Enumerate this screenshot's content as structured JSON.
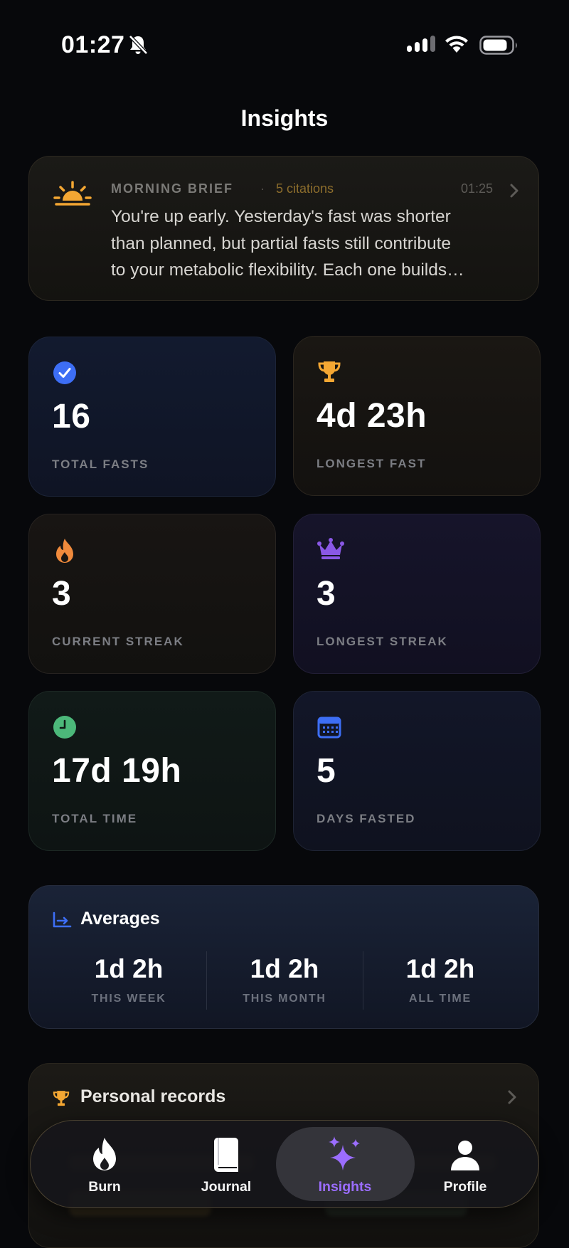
{
  "status_bar": {
    "time": "01:27"
  },
  "page": {
    "title": "Insights"
  },
  "brief": {
    "label": "MORNING BRIEF",
    "separator": "·",
    "citations": "5 citations",
    "time": "01:25",
    "lines": [
      "You're up early. Yesterday's fast was shorter",
      "than planned, but partial fasts still contribute",
      "to your metabolic flexibility. Each one builds…"
    ]
  },
  "stats": [
    {
      "icon": "check-circle-icon",
      "value": "16",
      "label": "TOTAL FASTS",
      "color": "#3d6ef5"
    },
    {
      "icon": "trophy-icon",
      "value": "4d 23h",
      "label": "LONGEST FAST",
      "color": "#f4a733"
    },
    {
      "icon": "flame-icon",
      "value": "3",
      "label": "CURRENT STREAK",
      "color": "#f08a3c"
    },
    {
      "icon": "crown-icon",
      "value": "3",
      "label": "LONGEST STREAK",
      "color": "#8a58e6"
    },
    {
      "icon": "clock-icon",
      "value": "17d 19h",
      "label": "TOTAL TIME",
      "color": "#4cb87a"
    },
    {
      "icon": "calendar-icon",
      "value": "5",
      "label": "DAYS FASTED",
      "color": "#3d6ef5"
    }
  ],
  "averages": {
    "title": "Averages",
    "items": [
      {
        "value": "1d 2h",
        "label": "THIS WEEK"
      },
      {
        "value": "1d 2h",
        "label": "THIS MONTH"
      },
      {
        "value": "1d 2h",
        "label": "ALL TIME"
      }
    ]
  },
  "records": {
    "title": "Personal records"
  },
  "tab_bar": {
    "items": [
      {
        "label": "Burn",
        "icon": "flame-icon"
      },
      {
        "label": "Journal",
        "icon": "book-icon"
      },
      {
        "label": "Insights",
        "icon": "sparkles-icon",
        "active": true
      },
      {
        "label": "Profile",
        "icon": "person-icon"
      }
    ]
  },
  "colors": {
    "background": "#07080b",
    "accent_purple": "#9b6dff",
    "accent_gold": "#f4a733",
    "accent_blue": "#3d6ef5"
  }
}
